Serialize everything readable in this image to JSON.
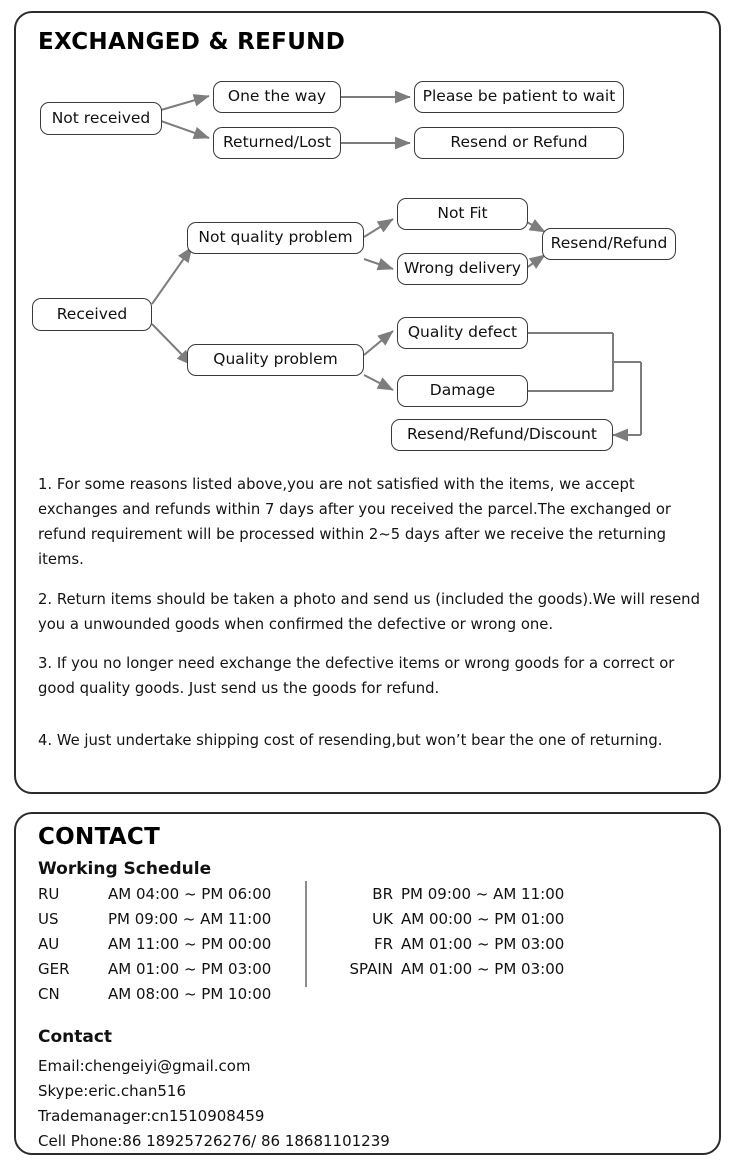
{
  "exchange_card": {
    "title": "EXCHANGED & REFUND",
    "flow_not_received": {
      "root": "Not received",
      "branches": [
        {
          "condition": "One the way",
          "outcome": "Please be patient to wait"
        },
        {
          "condition": "Returned/Lost",
          "outcome": "Resend or Refund"
        }
      ]
    },
    "flow_received": {
      "root": "Received",
      "branches": [
        {
          "category": "Not quality problem",
          "reasons": [
            "Not Fit",
            "Wrong delivery"
          ],
          "outcome": "Resend/Refund"
        },
        {
          "category": "Quality problem",
          "reasons": [
            "Quality defect",
            "Damage"
          ],
          "outcome": "Resend/Refund/Discount"
        }
      ]
    },
    "paragraphs": [
      "1. For some reasons listed above,you are not satisfied with the items, we accept exchanges and refunds within 7 days after you received the parcel.The exchanged or refund requirement will be processed within 2~5 days after we receive the returning items.",
      "2. Return items should be taken a photo and send us (included the goods).We will resend you a unwounded goods when confirmed the defective or wrong one.",
      "3. If you no longer need exchange the defective items or wrong goods for a correct or good quality goods. Just send us the goods for refund.",
      "4. We just undertake shipping cost of resending,but won’t bear the one of returning."
    ]
  },
  "contact_card": {
    "title": "CONTACT",
    "working_schedule_heading": "Working Schedule",
    "schedule_left": [
      {
        "country": "RU",
        "hours": "AM 04:00 ~ PM 06:00"
      },
      {
        "country": "US",
        "hours": "PM 09:00 ~ AM 11:00"
      },
      {
        "country": "AU",
        "hours": "AM 11:00 ~ PM 00:00"
      },
      {
        "country": "GER",
        "hours": "AM 01:00 ~ PM 03:00"
      },
      {
        "country": "CN",
        "hours": "AM 08:00 ~ PM 10:00"
      }
    ],
    "schedule_right": [
      {
        "country": "BR",
        "hours": "PM 09:00 ~ AM 11:00"
      },
      {
        "country": "UK",
        "hours": "AM 00:00 ~ PM 01:00"
      },
      {
        "country": "FR",
        "hours": "AM 01:00 ~ PM 03:00"
      },
      {
        "country": "SPAIN",
        "hours": "AM 01:00 ~ PM 03:00"
      }
    ],
    "contact_heading": "Contact",
    "contact_lines": [
      "Email:chengeiyi@gmail.com",
      "Skype:eric.chan516",
      "Trademanager:cn1510908459",
      "Cell Phone:86 18925726276/ 86 18681101239"
    ]
  },
  "colors": {
    "card_border": "#2b2b2b",
    "node_border": "#3a3a3a",
    "connector": "#7d7d7d",
    "text": "#141414"
  }
}
